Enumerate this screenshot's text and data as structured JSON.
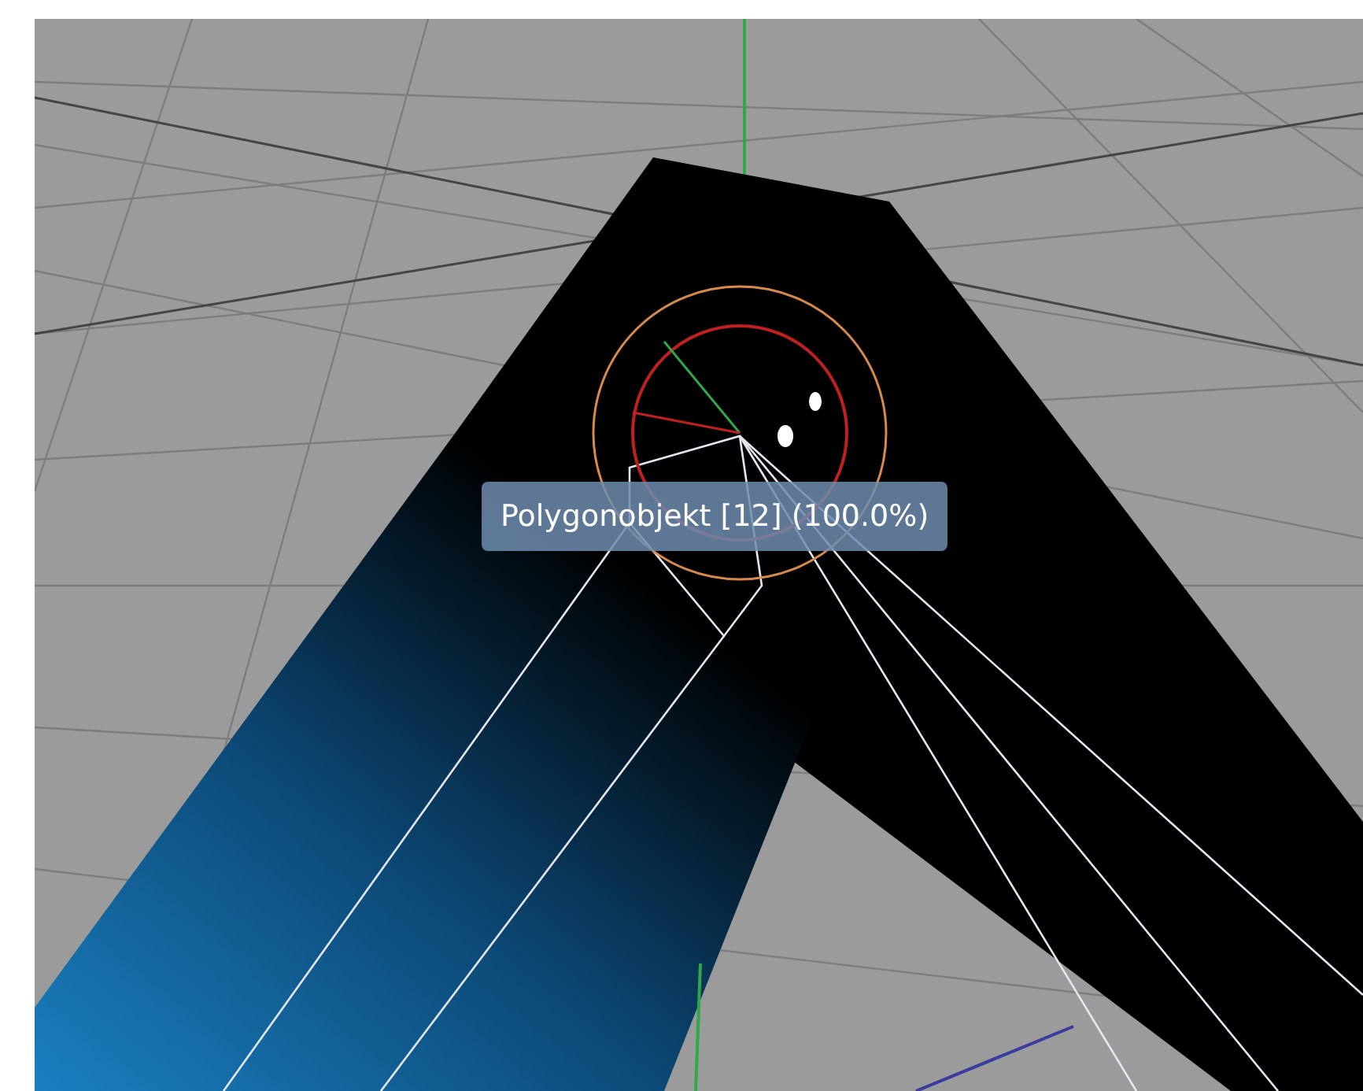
{
  "viewport": {
    "tooltip": "Polygonobjekt [12] (100.0%)"
  }
}
